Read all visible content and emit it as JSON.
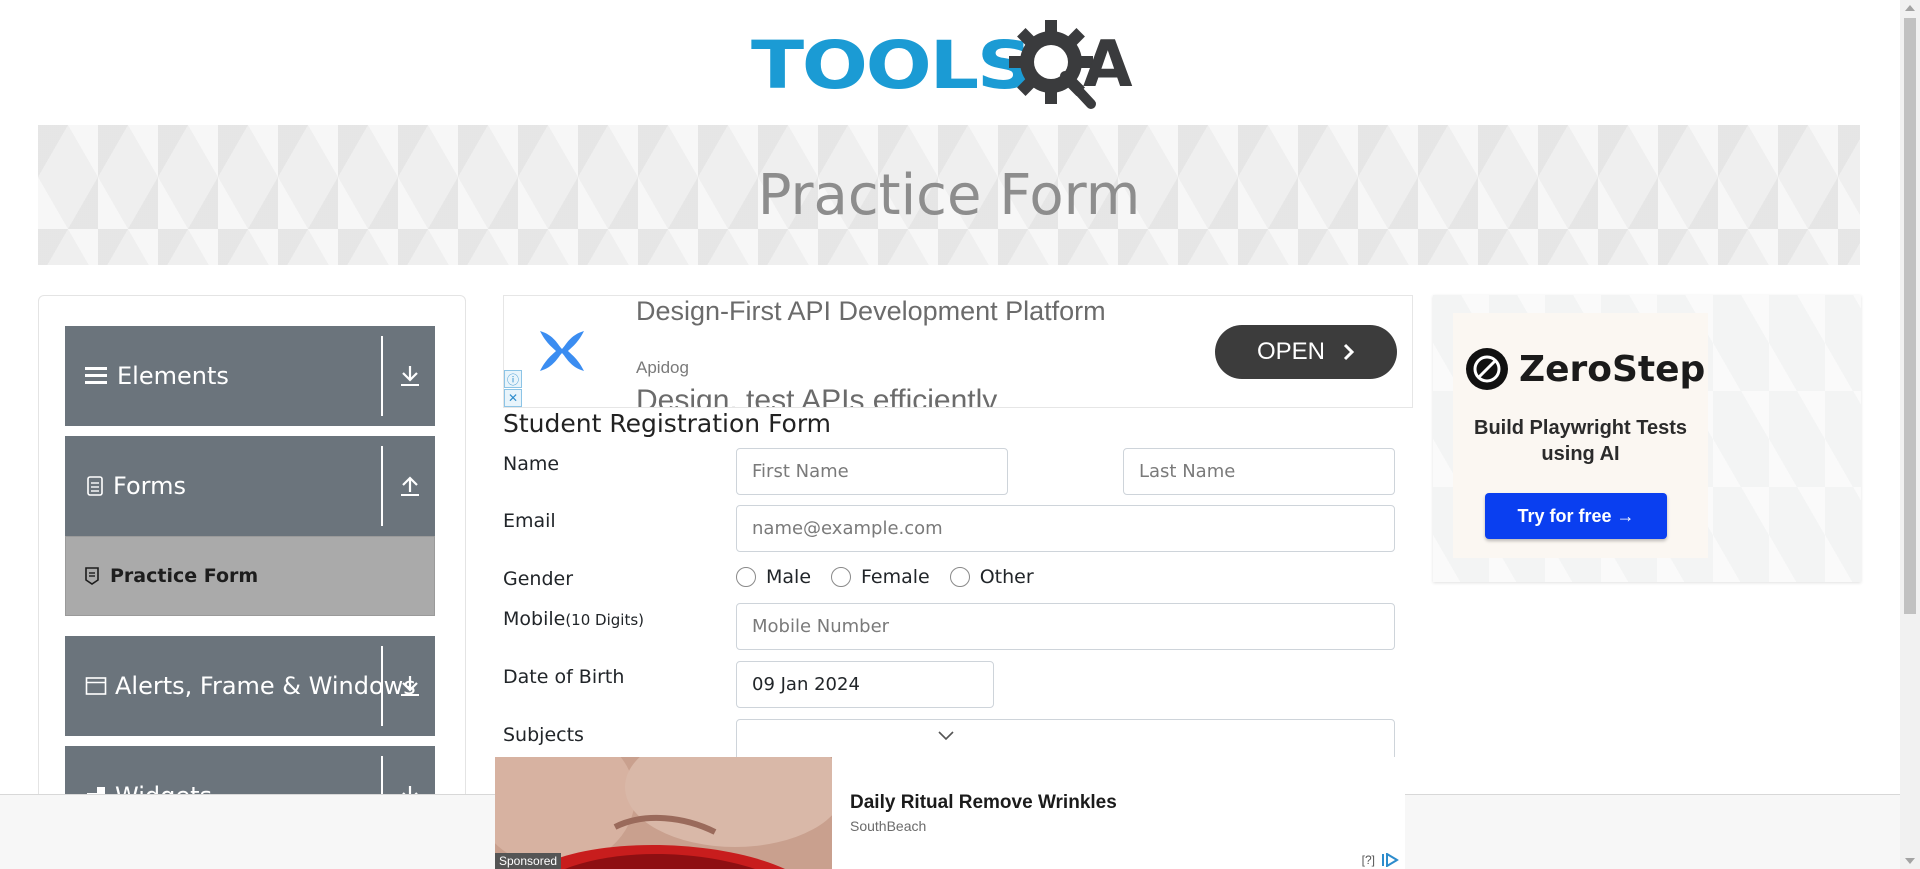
{
  "header": {
    "logo_text": "TOOLS",
    "logo_suffix": "A"
  },
  "banner": {
    "title": "Practice Form"
  },
  "sidebar": {
    "groups": [
      {
        "label": "Elements",
        "icon": "hamburger-icon",
        "toggle": "download-icon"
      },
      {
        "label": "Forms",
        "icon": "document-icon",
        "toggle": "upload-icon"
      },
      {
        "label": "Alerts, Frame & Windows",
        "icon": "window-icon",
        "toggle": "download-icon"
      },
      {
        "label": "Widgets",
        "icon": "widget-icon",
        "toggle": "download-icon"
      }
    ],
    "active_item": "Practice Form"
  },
  "top_ad": {
    "title": "Design-First API Development Platform",
    "brand": "Apidog",
    "description": "Design, test APIs efficiently",
    "button": "OPEN",
    "info_icon": "ⓘ",
    "close_icon": "✕"
  },
  "form": {
    "title": "Student Registration Form",
    "name_label": "Name",
    "first_name_placeholder": "First Name",
    "last_name_placeholder": "Last Name",
    "email_label": "Email",
    "email_placeholder": "name@example.com",
    "gender_label": "Gender",
    "gender_options": [
      "Male",
      "Female",
      "Other"
    ],
    "mobile_label": "Mobile",
    "mobile_hint": "(10 Digits)",
    "mobile_placeholder": "Mobile Number",
    "dob_label": "Date of Birth",
    "dob_value": "09 Jan 2024",
    "subjects_label": "Subjects"
  },
  "right_ad": {
    "brand": "ZeroStep",
    "text": "Build Playwright Tests using AI",
    "button": "Try for free →"
  },
  "sponsored_ad": {
    "tag": "Sponsored",
    "headline": "Daily Ritual Remove Wrinkles",
    "source": "SouthBeach",
    "help": "[?]"
  },
  "colors": {
    "brand_blue": "#1b9bd4",
    "sidebar_gray": "#6b747c",
    "active_gray": "#aaaaaa",
    "cta_blue": "#0a3ff0"
  }
}
